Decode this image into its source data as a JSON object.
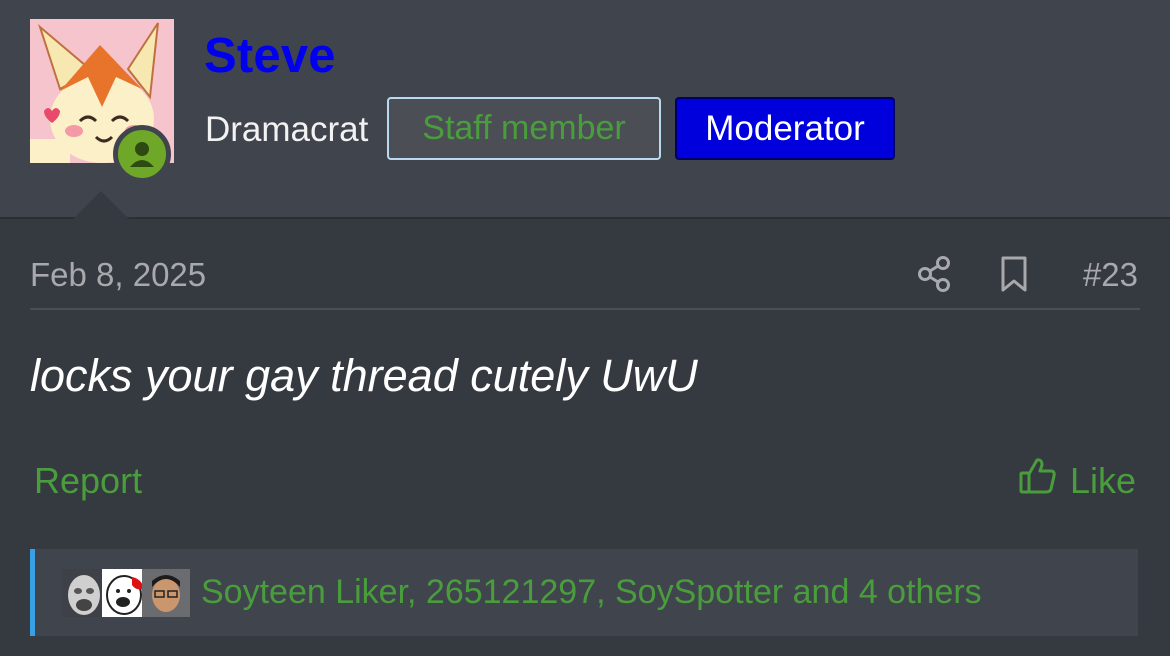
{
  "user": {
    "name": "Steve",
    "title": "Dramacrat",
    "badges": {
      "staff": "Staff member",
      "moderator": "Moderator"
    },
    "avatar_icon": "pokemon-avatar",
    "online_icon": "user-online-icon"
  },
  "post": {
    "date": "Feb 8, 2025",
    "number": "#23",
    "body": "locks your gay thread cutely UwU",
    "share_icon": "share-icon",
    "bookmark_icon": "bookmark-icon"
  },
  "actions": {
    "report_label": "Report",
    "like_label": "Like",
    "like_icon": "thumbs-up-icon"
  },
  "reactions": {
    "summary": "Soyteen Liker, 265121297, SoySpotter and 4 others"
  },
  "colors": {
    "username": "#0000ee",
    "link_green": "#4a9d3c",
    "moderator_bg": "#0000dd",
    "accent_bar": "#3aa0e6"
  }
}
